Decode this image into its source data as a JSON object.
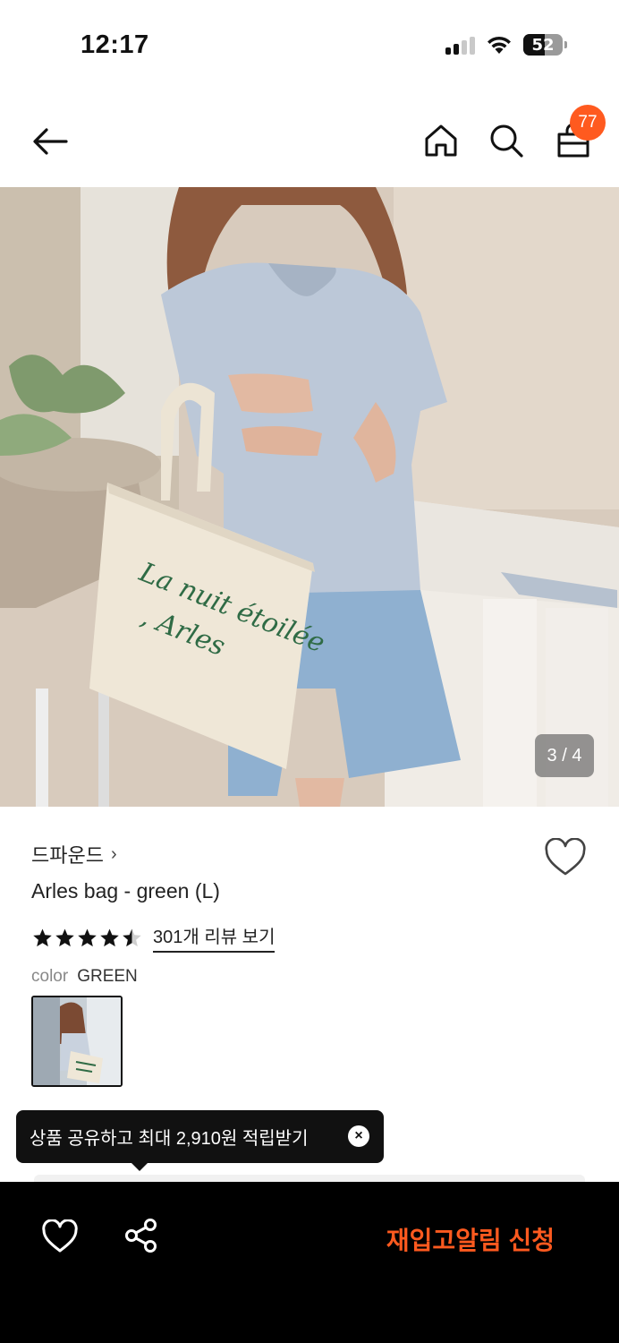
{
  "status_bar": {
    "time": "12:17",
    "battery": "52"
  },
  "header": {
    "cart_count": "77"
  },
  "gallery": {
    "counter": "3 / 4"
  },
  "product": {
    "brand": "드파운드",
    "brand_chevron": "›",
    "title": "Arles bag - green (L)",
    "rating_value": 4.5,
    "review_link": "301개 리뷰 보기",
    "color_label": "color",
    "color_value": "GREEN"
  },
  "tooltip": {
    "text": "상품 공유하고 최대 2,910원 적립받기",
    "close": "×"
  },
  "bottom_bar": {
    "restock_label": "재입고알림 신청"
  },
  "colors": {
    "accent": "#ff5a1f",
    "bar_bg": "#000000",
    "text": "#222222"
  },
  "icons": [
    "back-arrow-icon",
    "home-icon",
    "search-icon",
    "shopping-bag-icon",
    "heart-icon",
    "star-icon",
    "share-icon",
    "close-icon"
  ]
}
